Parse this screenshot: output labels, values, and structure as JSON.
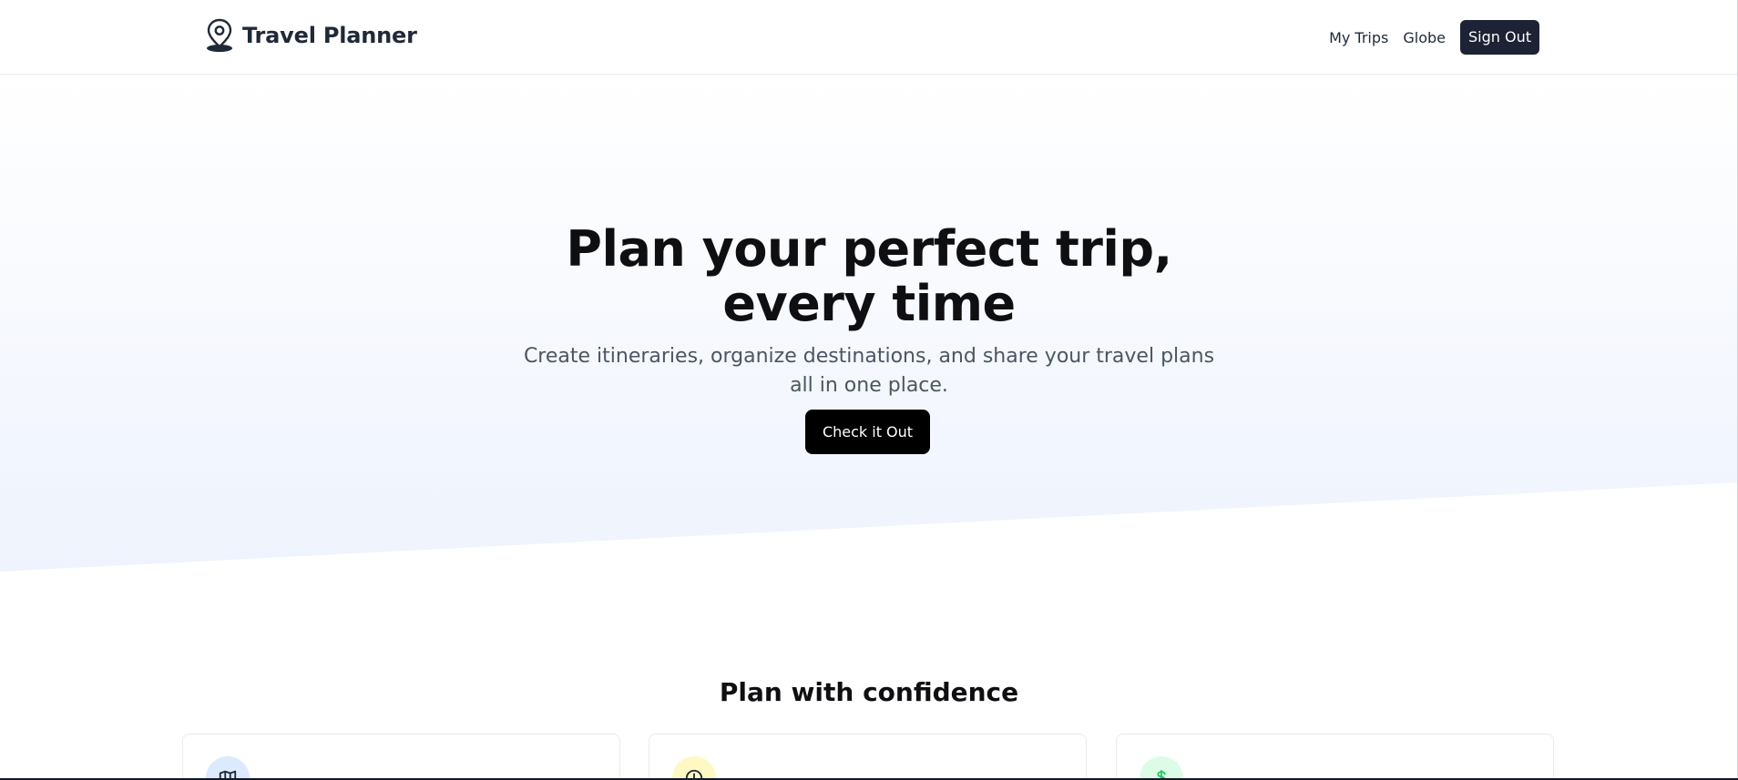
{
  "header": {
    "brand_name": "Travel Planner",
    "brand_icon": "map-pin-icon",
    "nav": [
      {
        "label": "My Trips"
      },
      {
        "label": "Globe"
      }
    ],
    "signout_label": "Sign Out"
  },
  "hero": {
    "title_line1": "Plan your perfect trip,",
    "title_line2": "every time",
    "subtitle": "Create itineraries, organize destinations, and share your travel plans all in one place.",
    "cta_label": "Check it Out"
  },
  "features": {
    "title": "Plan with confidence",
    "cards": [
      {
        "icon": "map-icon",
        "icon_bg": "#dbeafe"
      },
      {
        "icon": "clock-icon",
        "icon_bg": "#fef9c3"
      },
      {
        "icon": "dollar-icon",
        "icon_bg": "#dcfce7"
      }
    ]
  },
  "colors": {
    "accent_dark": "#1e2235",
    "cta": "#000000",
    "hero_bg_tint": "#eef3fd"
  }
}
